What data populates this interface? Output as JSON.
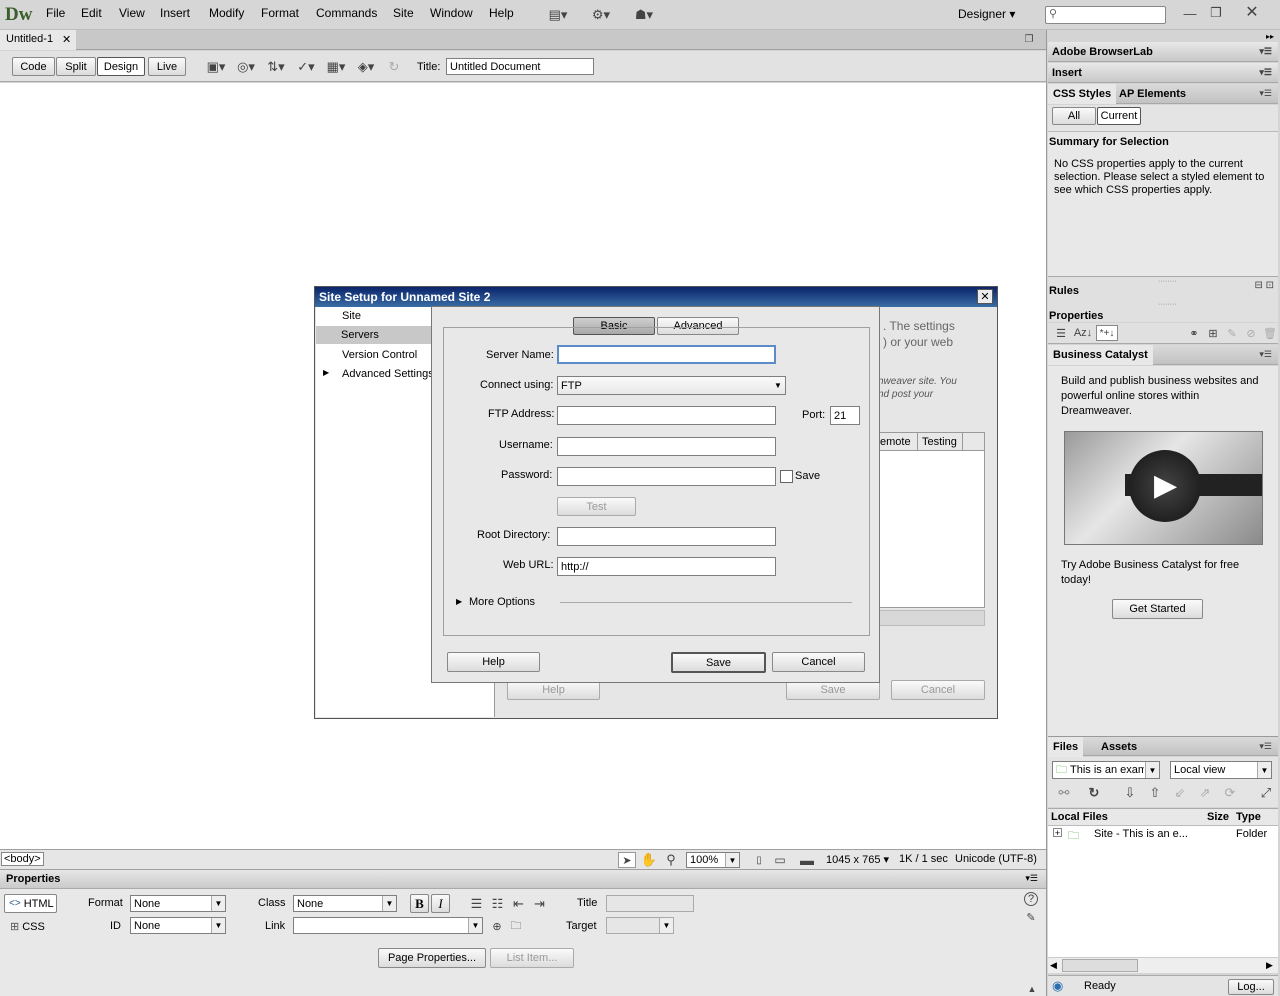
{
  "app": {
    "logo": "Dw",
    "menus": [
      "File",
      "Edit",
      "View",
      "Insert",
      "Modify",
      "Format",
      "Commands",
      "Site",
      "Window",
      "Help"
    ],
    "workspace": "Designer",
    "search_placeholder": ""
  },
  "document": {
    "tab_label": "Untitled-1",
    "view_buttons": [
      "Code",
      "Split",
      "Design",
      "Live"
    ],
    "title_label": "Title:",
    "title_value": "Untitled Document",
    "tag_selector": "<body>",
    "zoom": "100%",
    "window_size": "1045 x 765",
    "download": "1K / 1 sec",
    "encoding": "Unicode (UTF-8)"
  },
  "properties": {
    "header": "Properties",
    "html_btn": "HTML",
    "css_btn": "CSS",
    "format_label": "Format",
    "format_value": "None",
    "class_label": "Class",
    "class_value": "None",
    "id_label": "ID",
    "id_value": "None",
    "link_label": "Link",
    "title_label": "Title",
    "target_label": "Target",
    "page_properties": "Page Properties...",
    "list_item": "List Item..."
  },
  "panels": {
    "browserlab": "Adobe BrowserLab",
    "insert": "Insert",
    "css_tab": "CSS Styles",
    "ap_tab": "AP Elements",
    "all_btn": "All",
    "current_btn": "Current",
    "summary_title": "Summary for Selection",
    "summary_text": "No CSS properties apply to the current selection.  Please select a styled element to see which CSS properties apply.",
    "rules": "Rules",
    "properties": "Properties",
    "bc_tab": "Business Catalyst",
    "bc_text": "Build and publish business websites and powerful online stores within Dreamweaver.",
    "bc_try": "Try Adobe Business Catalyst for free today!",
    "bc_button": "Get Started",
    "files_tab": "Files",
    "assets_tab": "Assets",
    "site_select": "This is an exam",
    "view_select": "Local view",
    "col_local": "Local Files",
    "col_size": "Size",
    "col_type": "Type",
    "row_name": "Site - This is an e...",
    "row_type": "Folder",
    "status": "Ready",
    "log_btn": "Log..."
  },
  "site_dialog": {
    "title": "Site Setup for Unnamed Site 2",
    "nav": [
      "Site",
      "Servers",
      "Version Control",
      "Advanced Settings"
    ],
    "bg_text1": ". The settings",
    "bg_text2": ") or your web",
    "bg_text3": "nweaver site. You",
    "bg_text4": "nd post your",
    "bg_col_remote": "emote",
    "bg_col_testing": "Testing",
    "bg_help": "Help",
    "bg_save": "Save",
    "bg_cancel": "Cancel"
  },
  "server_dialog": {
    "tab_basic": "Basic",
    "tab_advanced": "Advanced",
    "server_name_label": "Server Name:",
    "server_name_value": "",
    "connect_label": "Connect using:",
    "connect_value": "FTP",
    "ftp_label": "FTP Address:",
    "ftp_value": "",
    "port_label": "Port:",
    "port_value": "21",
    "username_label": "Username:",
    "username_value": "",
    "password_label": "Password:",
    "password_value": "",
    "save_checkbox": "Save",
    "test_btn": "Test",
    "root_label": "Root Directory:",
    "root_value": "",
    "url_label": "Web URL:",
    "url_value": "http://",
    "more_options": "More Options",
    "help_btn": "Help",
    "save_btn": "Save",
    "cancel_btn": "Cancel"
  }
}
